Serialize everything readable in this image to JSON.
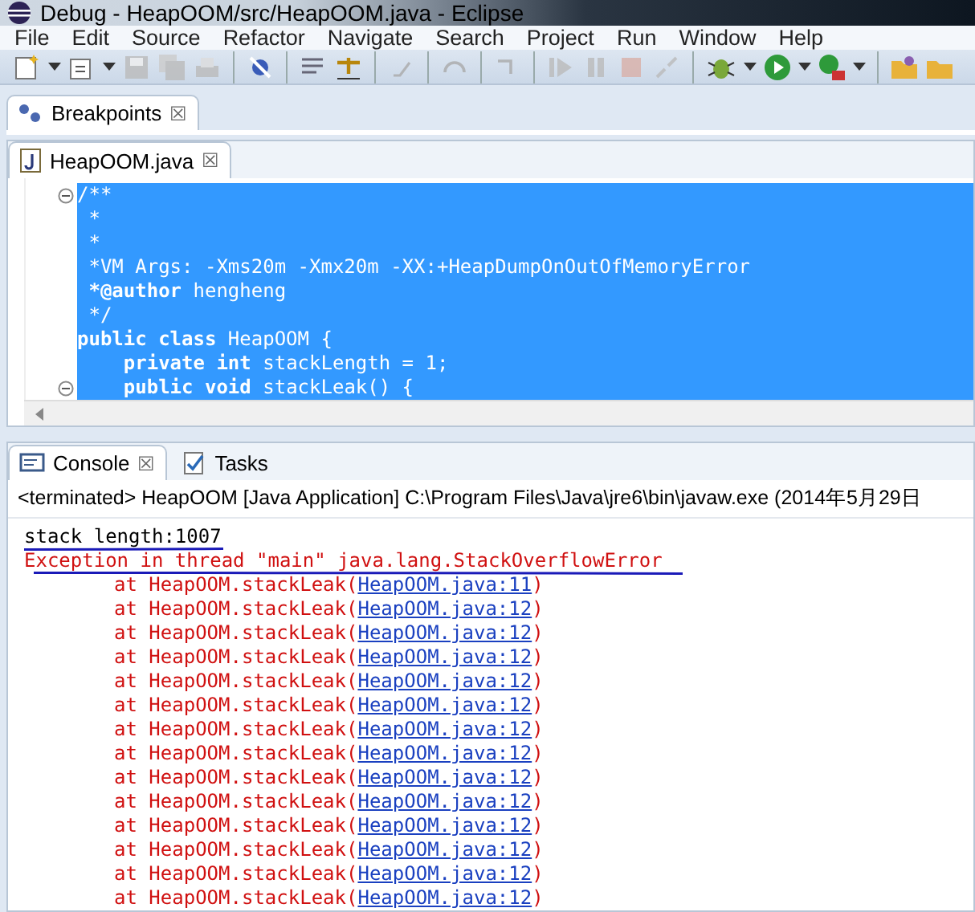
{
  "window": {
    "title": "Debug - HeapOOM/src/HeapOOM.java - Eclipse"
  },
  "menu": [
    "File",
    "Edit",
    "Source",
    "Refactor",
    "Navigate",
    "Search",
    "Project",
    "Run",
    "Window",
    "Help"
  ],
  "breakpoints_view": {
    "tab": "Breakpoints",
    "close": "☒"
  },
  "editor": {
    "tab": "HeapOOM.java",
    "close": "☒",
    "lines": [
      {
        "text": "/**",
        "fold": true
      },
      {
        "text": " *",
        "fold": false
      },
      {
        "text": " *",
        "fold": false
      },
      {
        "text": " *VM Args: -Xms20m -Xmx20m -XX:+HeapDumpOnOutOfMemoryError",
        "fold": false
      },
      {
        "text": " ***@author** hengheng",
        "fold": false
      },
      {
        "text": " */",
        "fold": false
      },
      {
        "text": "**public class** HeapOOM {",
        "fold": false
      },
      {
        "text": "    **private int** stackLength = 1;",
        "fold": false
      },
      {
        "text": "    **public void** stackLeak() {",
        "fold": true
      }
    ]
  },
  "console": {
    "tabs": [
      {
        "label": "Console",
        "selected": true,
        "close": "☒"
      },
      {
        "label": "Tasks",
        "selected": false
      }
    ],
    "header": "<terminated> HeapOOM [Java Application] C:\\Program Files\\Java\\jre6\\bin\\javaw.exe (2014年5月29日",
    "lines": [
      {
        "kind": "plain",
        "text": "stack length:1007"
      },
      {
        "kind": "error",
        "text": "Exception in thread \"main\" java.lang.StackOverflowError"
      },
      {
        "kind": "trace",
        "text": "at HeapOOM.stackLeak(",
        "link": "HeapOOM.java:11",
        "end": ")"
      },
      {
        "kind": "trace",
        "text": "at HeapOOM.stackLeak(",
        "link": "HeapOOM.java:12",
        "end": ")"
      },
      {
        "kind": "trace",
        "text": "at HeapOOM.stackLeak(",
        "link": "HeapOOM.java:12",
        "end": ")"
      },
      {
        "kind": "trace",
        "text": "at HeapOOM.stackLeak(",
        "link": "HeapOOM.java:12",
        "end": ")"
      },
      {
        "kind": "trace",
        "text": "at HeapOOM.stackLeak(",
        "link": "HeapOOM.java:12",
        "end": ")"
      },
      {
        "kind": "trace",
        "text": "at HeapOOM.stackLeak(",
        "link": "HeapOOM.java:12",
        "end": ")"
      },
      {
        "kind": "trace",
        "text": "at HeapOOM.stackLeak(",
        "link": "HeapOOM.java:12",
        "end": ")"
      },
      {
        "kind": "trace",
        "text": "at HeapOOM.stackLeak(",
        "link": "HeapOOM.java:12",
        "end": ")"
      },
      {
        "kind": "trace",
        "text": "at HeapOOM.stackLeak(",
        "link": "HeapOOM.java:12",
        "end": ")"
      },
      {
        "kind": "trace",
        "text": "at HeapOOM.stackLeak(",
        "link": "HeapOOM.java:12",
        "end": ")"
      },
      {
        "kind": "trace",
        "text": "at HeapOOM.stackLeak(",
        "link": "HeapOOM.java:12",
        "end": ")"
      },
      {
        "kind": "trace",
        "text": "at HeapOOM.stackLeak(",
        "link": "HeapOOM.java:12",
        "end": ")"
      },
      {
        "kind": "trace",
        "text": "at HeapOOM.stackLeak(",
        "link": "HeapOOM.java:12",
        "end": ")"
      },
      {
        "kind": "trace",
        "text": "at HeapOOM.stackLeak(",
        "link": "HeapOOM.java:12",
        "end": ")"
      }
    ]
  }
}
